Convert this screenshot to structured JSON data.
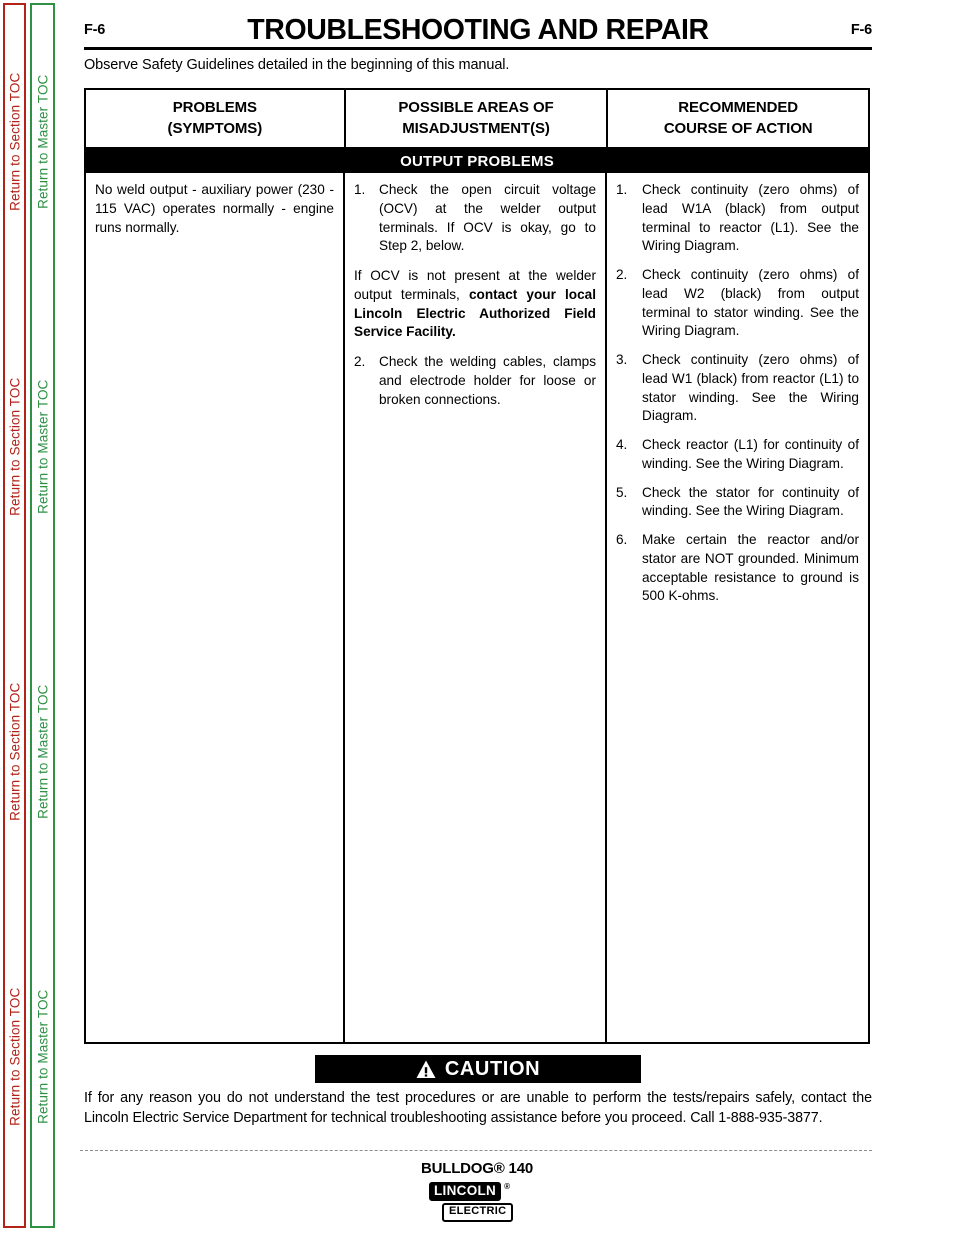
{
  "sidebar": {
    "section_toc_label": "Return to Section TOC",
    "master_toc_label": "Return to Master TOC",
    "section_toc_color": "#b32317",
    "master_toc_color": "#2e9144",
    "repeat_count": 4
  },
  "header": {
    "folio_left": "F-6",
    "folio_right": "F-6",
    "title": "TROUBLESHOOTING AND REPAIR",
    "safety_note": "Observe Safety Guidelines detailed in the beginning of this manual."
  },
  "table": {
    "headers": {
      "col1_line1": "PROBLEMS",
      "col1_line2": "(SYMPTOMS)",
      "col2_line1": "POSSIBLE AREAS OF",
      "col2_line2": "MISADJUSTMENT(S)",
      "col3_line1": "RECOMMENDED",
      "col3_line2": "COURSE OF ACTION"
    },
    "section_band": "OUTPUT PROBLEMS",
    "row": {
      "problem": "No weld output - auxiliary power (230 - 115 VAC) operates normally - engine runs normally.",
      "misadjustments": [
        {
          "num": "1.",
          "text": "Check the open circuit voltage (OCV) at the welder output terminals.  If OCV is okay, go to Step 2, below."
        }
      ],
      "misadjustment_note_plain": "If OCV is not present at the welder output terminals,  ",
      "misadjustment_note_bold": "contact your local Lincoln Electric Authorized Field Service Facility.",
      "misadjustments_continued": [
        {
          "num": "2.",
          "text": "Check the welding cables, clamps and electrode holder for loose or broken connections."
        }
      ],
      "actions": [
        {
          "num": "1.",
          "text": "Check continuity (zero ohms) of lead W1A (black) from output terminal to reactor (L1).   See the Wiring Diagram."
        },
        {
          "num": "2.",
          "text": "Check continuity (zero ohms) of lead W2 (black) from output terminal to stator winding.  See the Wiring Diagram."
        },
        {
          "num": "3.",
          "text": "Check continuity (zero ohms) of lead W1 (black) from reactor (L1) to stator winding.  See the Wiring Diagram."
        },
        {
          "num": "4.",
          "text": "Check reactor (L1) for continuity of winding.  See the Wiring Diagram."
        },
        {
          "num": "5.",
          "text": "Check the stator for continuity of winding.  See the Wiring Diagram."
        },
        {
          "num": "6.",
          "text": "Make certain the reactor and/or stator are NOT grounded.  Minimum acceptable resistance to ground is 500 K-ohms."
        }
      ]
    }
  },
  "caution": {
    "label": "CAUTION",
    "icon": "warning-triangle-icon",
    "text": "If for any reason you do not understand the test procedures or are unable to perform the tests/repairs safely, contact the Lincoln Electric Service Department for technical troubleshooting assistance before you proceed. Call 1-888-935-3877."
  },
  "footer": {
    "model": "BULLDOG® 140",
    "logo_primary": "LINCOLN",
    "logo_registered": "®",
    "logo_secondary": "ELECTRIC"
  }
}
